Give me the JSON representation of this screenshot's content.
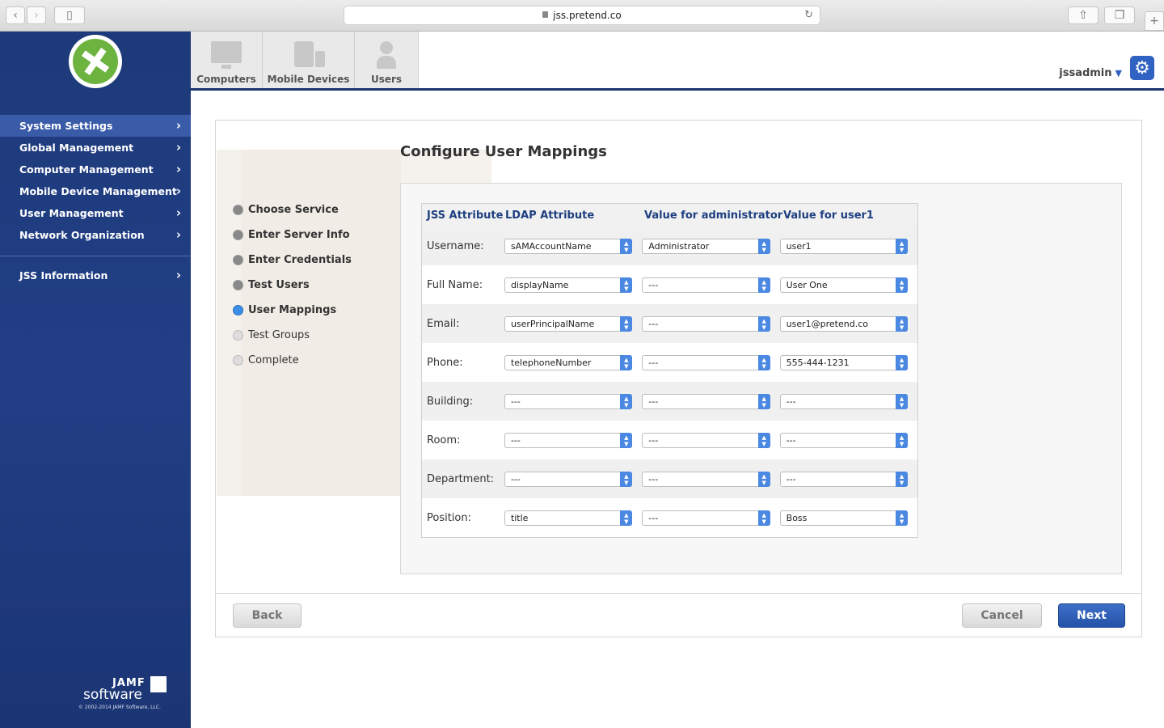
{
  "browser": {
    "url": "jss.pretend.co"
  },
  "sidebar": {
    "items": [
      {
        "label": "System Settings"
      },
      {
        "label": "Global Management"
      },
      {
        "label": "Computer Management"
      },
      {
        "label": "Mobile Device Management"
      },
      {
        "label": "User Management"
      },
      {
        "label": "Network Organization"
      }
    ],
    "info": "JSS Information",
    "brand_top": "JAMF",
    "brand_bottom": "software",
    "copyright": "© 2002-2014 JAMF Software, LLC."
  },
  "tabs": [
    {
      "label": "Computers"
    },
    {
      "label": "Mobile Devices"
    },
    {
      "label": "Users"
    }
  ],
  "user": {
    "name": "jssadmin",
    "caret": "▼"
  },
  "wizard": {
    "title": "Configure User Mappings",
    "steps": [
      {
        "label": "Choose Service"
      },
      {
        "label": "Enter Server Info"
      },
      {
        "label": "Enter Credentials"
      },
      {
        "label": "Test Users"
      },
      {
        "label": "User Mappings"
      },
      {
        "label": "Test Groups"
      },
      {
        "label": "Complete"
      }
    ],
    "headers": [
      "JSS Attribute",
      "LDAP Attribute",
      "Value for administrator",
      "Value for user1"
    ],
    "rows": [
      {
        "label": "Username:",
        "ldap": "sAMAccountName",
        "admin": "Administrator",
        "user1": "user1"
      },
      {
        "label": "Full Name:",
        "ldap": "displayName",
        "admin": "---",
        "user1": "User One"
      },
      {
        "label": "Email:",
        "ldap": "userPrincipalName",
        "admin": "---",
        "user1": "user1@pretend.co"
      },
      {
        "label": "Phone:",
        "ldap": "telephoneNumber",
        "admin": "---",
        "user1": "555-444-1231"
      },
      {
        "label": "Building:",
        "ldap": "---",
        "admin": "---",
        "user1": "---"
      },
      {
        "label": "Room:",
        "ldap": "---",
        "admin": "---",
        "user1": "---"
      },
      {
        "label": "Department:",
        "ldap": "---",
        "admin": "---",
        "user1": "---"
      },
      {
        "label": "Position:",
        "ldap": "title",
        "admin": "---",
        "user1": "Boss"
      }
    ],
    "buttons": {
      "back": "Back",
      "cancel": "Cancel",
      "next": "Next"
    }
  }
}
